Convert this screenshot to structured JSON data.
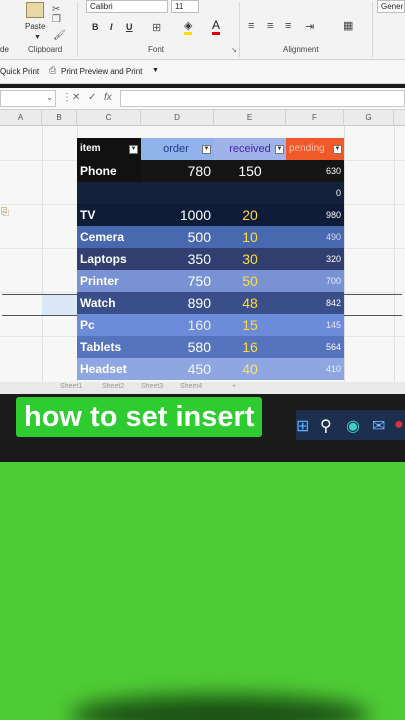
{
  "ribbon": {
    "font_name": "Calibri",
    "font_size": "11",
    "paste_label": "Paste",
    "clipboard_label": "Clipboard",
    "font_label": "Font",
    "alignment_label": "Alignment",
    "general_label": "Gener",
    "bold": "B",
    "italic": "I",
    "underline": "U",
    "left_edge_label": "de"
  },
  "qat": {
    "quick_print": "Quick Print",
    "print_preview": "Print Preview and Print"
  },
  "formula_bar": {
    "fx": "fx",
    "cancel": "✕",
    "enter": "✓"
  },
  "columns": [
    "A",
    "B",
    "C",
    "D",
    "E",
    "F",
    "G"
  ],
  "table": {
    "headers": {
      "item": "item",
      "order": "order",
      "received": "received",
      "pending": "pending"
    },
    "rows": [
      {
        "item": "Phone",
        "order": "780",
        "received": "150",
        "pending": "630"
      },
      {
        "item": "",
        "order": "",
        "received": "",
        "pending": "0"
      },
      {
        "item": "TV",
        "order": "1000",
        "received": "20",
        "pending": "980"
      },
      {
        "item": "Cemera",
        "order": "500",
        "received": "10",
        "pending": "490"
      },
      {
        "item": "Laptops",
        "order": "350",
        "received": "30",
        "pending": "320"
      },
      {
        "item": "Printer",
        "order": "750",
        "received": "50",
        "pending": "700"
      },
      {
        "item": "Watch",
        "order": "890",
        "received": "48",
        "pending": "842"
      },
      {
        "item": "Pc",
        "order": "160",
        "received": "15",
        "pending": "145"
      },
      {
        "item": "Tablets",
        "order": "580",
        "received": "16",
        "pending": "564"
      },
      {
        "item": "Headset",
        "order": "450",
        "received": "40",
        "pending": "410"
      }
    ]
  },
  "sheet_tabs": [
    "Sheet1",
    "Sheet2",
    "Sheet3",
    "Sheet4"
  ],
  "caption": "how to set insert",
  "colors": {
    "caption_bg": "#2ecc31",
    "green_screen": "#4fcc35",
    "pending_header": "#f05a28",
    "order_header": "#8fb3ea"
  }
}
